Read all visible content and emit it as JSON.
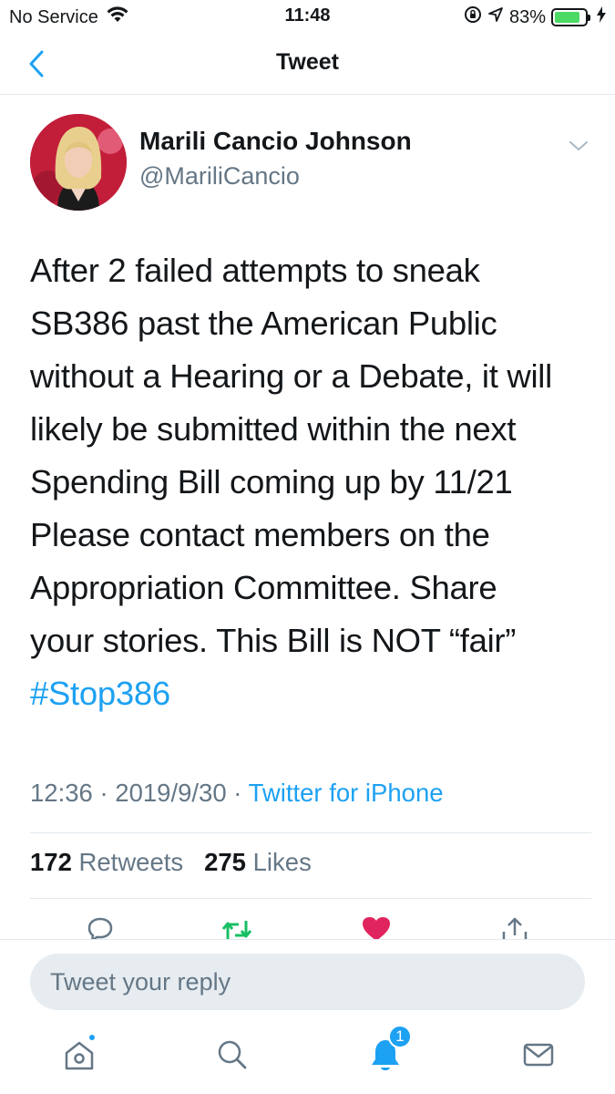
{
  "status_bar": {
    "carrier": "No Service",
    "time": "11:48",
    "battery": "83%",
    "battery_level": 0.83
  },
  "nav": {
    "title": "Tweet",
    "back_icon": "chevron-left-icon"
  },
  "tweet": {
    "author_name": "Marili Cancio Johnson",
    "author_handle": "@MariliCancio",
    "lines": [
      "After 2 failed attempts to sneak",
      "SB386 past the American Public",
      "without a Hearing or a Debate, it will",
      "likely be submitted within the next",
      "Spending Bill coming up by 11/21",
      "Please contact members on the",
      "Appropriation Committee. Share",
      "your stories. This Bill is NOT “fair”"
    ],
    "hashtag": "#Stop386",
    "time": "12:36",
    "date": "2019/9/30",
    "source": "Twitter for iPhone",
    "retweet_count": "172",
    "retweet_label": "Retweets",
    "like_count": "275",
    "like_label": "Likes"
  },
  "actions": [
    {
      "name": "reply",
      "icon": "comment-icon",
      "color": "#657786"
    },
    {
      "name": "retweet",
      "icon": "retweet-icon",
      "color": "#17bf63"
    },
    {
      "name": "like",
      "icon": "heart-icon",
      "color": "#e0245e"
    },
    {
      "name": "share",
      "icon": "share-icon",
      "color": "#657786"
    }
  ],
  "reply": {
    "placeholder": "Tweet your reply"
  },
  "tabbar": {
    "notifications_badge": "1",
    "tabs": [
      "home-icon",
      "search-icon",
      "bell-icon",
      "mail-icon"
    ]
  },
  "colors": {
    "accent": "#1da1f2",
    "secondary_text": "#657786",
    "primary_text": "#14171a",
    "retweeted": "#17bf63",
    "liked": "#e0245e",
    "avatar_bg": "#c21e3a"
  }
}
